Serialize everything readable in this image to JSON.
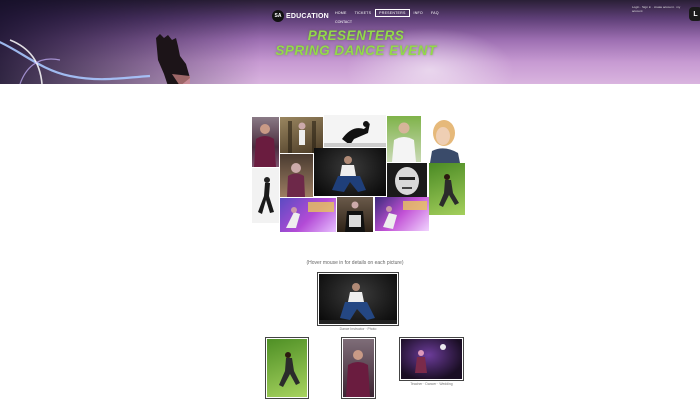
{
  "header": {
    "brand_badge": "SA",
    "brand_word": "EDUCATION",
    "nav": [
      {
        "label": "Home",
        "active": false
      },
      {
        "label": "Tickets",
        "active": false
      },
      {
        "label": "Presenters",
        "active": true
      },
      {
        "label": "Info",
        "active": false
      },
      {
        "label": "FAQ",
        "active": false
      }
    ],
    "nav_second_row": "Contact",
    "login_text": "Login · Sign in · create account · my account",
    "login_icon": "L",
    "hero_line1": "PRESENTERS",
    "hero_line2": "SPRING DANCE EVENT"
  },
  "gallery": {
    "intro": "(Hover mouse in for details on each picture)",
    "featured_caption": "Dance Instructor · Photo",
    "bottom_captions": [
      "",
      "",
      "Teacher · Dancer · Wedding"
    ]
  },
  "colors": {
    "accent_green": "#93d94a",
    "banner_dark": "#2a1f36",
    "banner_light": "#d9b4df"
  }
}
